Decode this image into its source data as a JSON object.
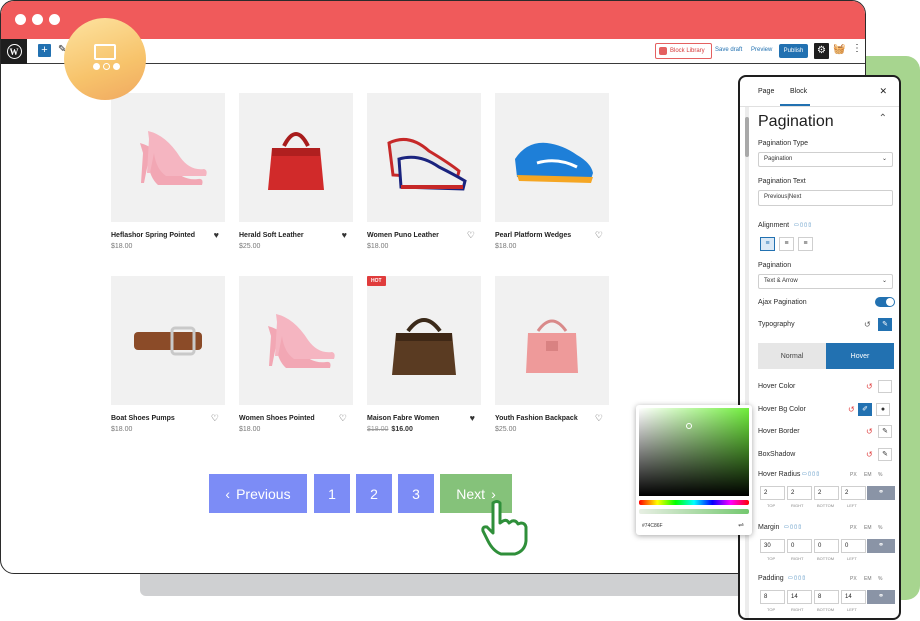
{
  "toolbar": {
    "add_symbol": "+",
    "block_library": "Block Library",
    "save_draft": "Save draft",
    "preview": "Preview",
    "publish": "Publish"
  },
  "products": [
    {
      "name": "Heflashor Spring Pointed",
      "price": "$18.00",
      "wishlisted": true
    },
    {
      "name": "Herald Soft Leather",
      "price": "$25.00",
      "wishlisted": true
    },
    {
      "name": "Women Puno Leather",
      "price": "$18.00",
      "wishlisted": false
    },
    {
      "name": "Pearl Platform Wedges",
      "price": "$18.00",
      "wishlisted": false
    },
    {
      "name": "Boat Shoes Pumps",
      "price": "$18.00",
      "wishlisted": false
    },
    {
      "name": "Women Shoes Pointed",
      "price": "$18.00",
      "wishlisted": false
    },
    {
      "name": "Maison Fabre Women",
      "old_price": "$18.00",
      "price": "$16.00",
      "badge": "HOT",
      "wishlisted": true
    },
    {
      "name": "Youth Fashion Backpack",
      "price": "$25.00",
      "wishlisted": false
    }
  ],
  "pagination": {
    "previous": "Previous",
    "pages": [
      "1",
      "2",
      "3"
    ],
    "next": "Next",
    "colors": {
      "page": "#7c8cf6",
      "next_hover": "#85c27a"
    }
  },
  "panel": {
    "tabs": [
      "Page",
      "Block"
    ],
    "active_tab": "Block",
    "title": "Pagination",
    "pagination_type_label": "Pagination Type",
    "pagination_type_value": "Pagination",
    "pagination_text_label": "Pagination Text",
    "pagination_text_value": "Previous|Next",
    "alignment_label": "Alignment",
    "pagination_label": "Pagination",
    "pagination_value": "Text & Arrow",
    "ajax_label": "Ajax Pagination",
    "typography_label": "Typography",
    "state_normal": "Normal",
    "state_hover": "Hover",
    "hover_color_label": "Hover Color",
    "hover_bg_label": "Hover Bg Color",
    "hover_border_label": "Hover Border",
    "boxshadow_label": "BoxShadow",
    "hover_radius_label": "Hover Radius",
    "units": [
      "PX",
      "EM",
      "%"
    ],
    "radius_values": [
      "2",
      "2",
      "2",
      "2"
    ],
    "dimension_labels": [
      "TOP",
      "RIGHT",
      "BOTTOM",
      "LEFT"
    ],
    "margin_label": "Margin",
    "margin_values": [
      "30",
      "0",
      "0",
      "0"
    ],
    "padding_label": "Padding",
    "padding_values": [
      "8",
      "14",
      "8",
      "14"
    ]
  },
  "color_picker": {
    "hex": "#74C86F",
    "hue_color": "#70ee3c"
  },
  "colors": {
    "titlebar": "#f05a5b",
    "accent": "#2271b1",
    "badge": "#f7c36b"
  }
}
